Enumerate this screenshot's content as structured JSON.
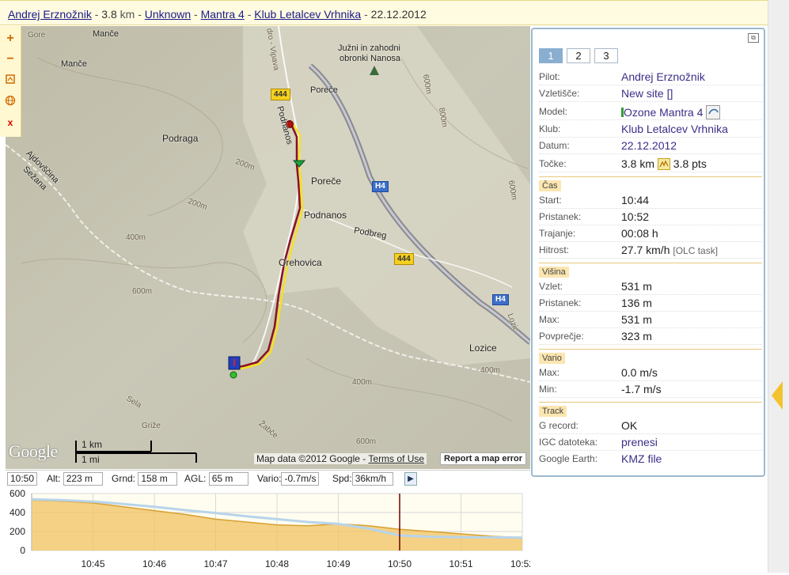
{
  "title_bar": {
    "pilot": "Andrej Erznožnik",
    "sep1": " - ",
    "distance": "3.8",
    "distance_unit": " km",
    "sep2": " - ",
    "site": "Unknown",
    "sep3": " - ",
    "glider": "Mantra 4",
    "sep4": " - ",
    "club": "Klub Letalcev Vrhnika",
    "sep5": " - ",
    "date": "22.12.2012"
  },
  "map_tools": {
    "zoom_in": "+",
    "zoom_out": "−",
    "close": "x"
  },
  "map": {
    "labels": {
      "mance1": "Manče",
      "mance2": "Manče",
      "gore": "Gore",
      "juzni1": "Južni in zahodni",
      "juzni2": "obronki Nanosa",
      "vipava": "dro - Vipava",
      "porece1": "Poreče",
      "porece2": "Poreče",
      "podnanos_rd": "Podnanos",
      "podraga": "Podraga",
      "podnanos": "Podnanos",
      "podbreg": "Podbreg",
      "orehovica": "Orehovica",
      "ajdovscina": "Ajdovščina",
      "sezana": "Sežana",
      "lozice": "Lozice",
      "sela": "Sela",
      "grize": "Griže",
      "zabce": "Žabče",
      "lozic_rd": "Lozic",
      "c200a": "200m",
      "c200b": "200m",
      "c400a": "400m",
      "c400b": "400m",
      "c400c": "400m",
      "c600a": "600m",
      "c600b": "600m",
      "c600c": "600m",
      "c600d": "600m",
      "c800": "800m"
    },
    "shields": {
      "r444a": "444",
      "r444b": "444",
      "h4a": "H4",
      "h4b": "H4"
    },
    "google": "Google",
    "scale_km": "1 km",
    "scale_mi": "1 mi",
    "attribution": "Map data ©2012 Google - ",
    "terms": "Terms of Use",
    "report": "Report a map error"
  },
  "status": {
    "time": "10:50",
    "alt_label": "Alt:",
    "alt": "223 m",
    "grnd_label": "Grnd:",
    "grnd": "158 m",
    "agl_label": "AGL:",
    "agl": "65 m",
    "vario_label": "Vario:",
    "vario": "-0.7m/s",
    "spd_label": "Spd:",
    "spd": "36km/h"
  },
  "chart_data": {
    "type": "area",
    "x": [
      "10:44:00",
      "10:44:30",
      "10:45:00",
      "10:45:30",
      "10:46:00",
      "10:46:30",
      "10:47:00",
      "10:47:30",
      "10:48:00",
      "10:48:30",
      "10:49:00",
      "10:49:30",
      "10:50:00",
      "10:50:30",
      "10:51:00",
      "10:51:30",
      "10:52:00"
    ],
    "series": [
      {
        "values": [
          531,
          520,
          500,
          460,
          420,
          380,
          330,
          300,
          270,
          260,
          280,
          260,
          223,
          200,
          175,
          150,
          136
        ]
      },
      {
        "values": [
          540,
          530,
          515,
          490,
          460,
          425,
          395,
          360,
          330,
          300,
          280,
          230,
          158,
          145,
          140,
          138,
          136
        ]
      }
    ],
    "x_ticks": [
      "10:45",
      "10:46",
      "10:47",
      "10:48",
      "10:49",
      "10:50",
      "10:51",
      "10:52"
    ],
    "y_ticks": [
      "600",
      "400",
      "200",
      "0"
    ],
    "ylim": [
      0,
      600
    ],
    "cursor": "10:50",
    "colors": {
      "track": "#f0c260",
      "track_line": "#d7a030",
      "ground": "#b8d4ea",
      "cursor": "#6b0000",
      "bg": "#fffdf0"
    }
  },
  "panel": {
    "tabs": [
      "1",
      "2",
      "3"
    ],
    "pilot_k": "Pilot:",
    "pilot_v": "Andrej Erznožnik",
    "site_k": "Vzletišče:",
    "site_v": "New site []",
    "model_k": "Model:",
    "model_v": "Ozone Mantra 4",
    "club_k": "Klub:",
    "club_v": "Klub Letalcev Vrhnika",
    "date_k": "Datum:",
    "date_v": "22.12.2012",
    "points_k": "Točke:",
    "points_km": "3.8 km",
    "points_pts": "3.8 pts",
    "sec_time": "Čas",
    "start_k": "Start:",
    "start_v": "10:44",
    "landing_k": "Pristanek:",
    "landing_v": "10:52",
    "dur_k": "Trajanje:",
    "dur_v": "00:08 h",
    "speed_k": "Hitrost:",
    "speed_v": "27.7 km/h",
    "speed_note": "[OLC task]",
    "sec_height": "Višina",
    "takeoff_k": "Vzlet:",
    "takeoff_v": "531 m",
    "land_h_k": "Pristanek:",
    "land_h_v": "136 m",
    "max_k": "Max:",
    "max_v": "531 m",
    "avg_k": "Povprečje:",
    "avg_v": "323 m",
    "sec_vario": "Vario",
    "vmax_k": "Max:",
    "vmax_v": "0.0 m/s",
    "vmin_k": "Min:",
    "vmin_v": "-1.7 m/s",
    "sec_track": "Track",
    "grec_k": "G record:",
    "grec_v": "OK",
    "igc_k": "IGC datoteka:",
    "igc_v": "prenesi",
    "ge_k": "Google Earth:",
    "ge_v": "KMZ file"
  }
}
